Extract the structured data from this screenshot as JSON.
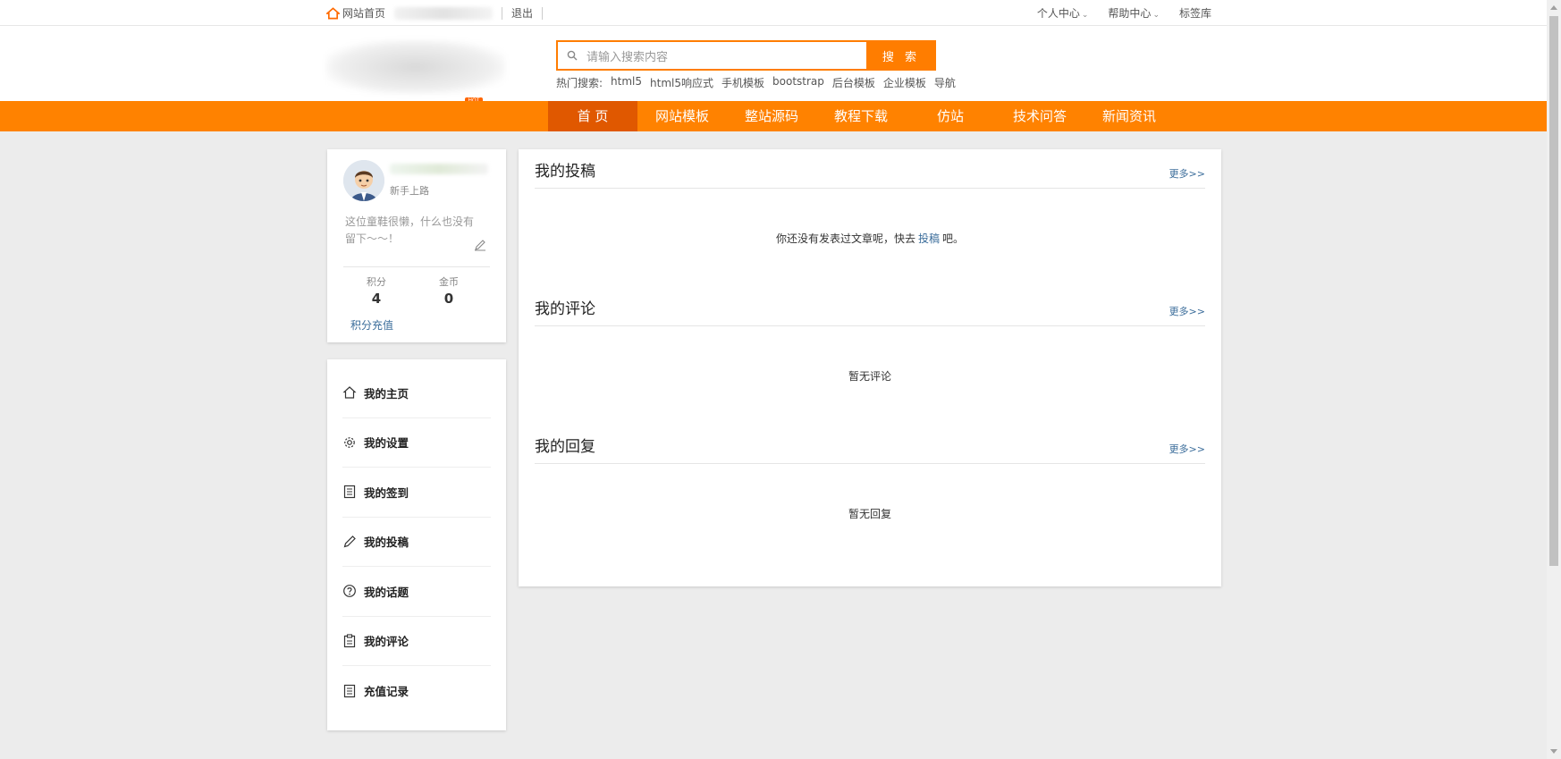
{
  "topbar": {
    "home": "网站首页",
    "logout": "退出",
    "right": [
      {
        "label": "个人中心",
        "has_arrow": true
      },
      {
        "label": "帮助中心",
        "has_arrow": true
      },
      {
        "label": "标签库",
        "has_arrow": false
      }
    ]
  },
  "header": {
    "hot_badge": "HOT",
    "search_placeholder": "请输入搜索内容",
    "search_button": "搜 索",
    "hot_label": "热门搜索:",
    "hot_terms": [
      "html5",
      "html5响应式",
      "手机模板",
      "bootstrap",
      "后台模板",
      "企业模板",
      "导航"
    ]
  },
  "nav": {
    "items": [
      "首 页",
      "网站模板",
      "整站源码",
      "教程下载",
      "仿站",
      "技术问答",
      "新闻资讯"
    ],
    "active_index": 0
  },
  "profile": {
    "level": "新手上路",
    "bio": "这位童鞋很懒，什么也没有留下～～！",
    "stats": [
      {
        "label": "积分",
        "value": "4"
      },
      {
        "label": "金币",
        "value": "0"
      }
    ],
    "recharge": "积分充值"
  },
  "menu": {
    "items": [
      {
        "label": "我的主页",
        "icon": "home-icon"
      },
      {
        "label": "我的设置",
        "icon": "gear-icon"
      },
      {
        "label": "我的签到",
        "icon": "list-icon"
      },
      {
        "label": "我的投稿",
        "icon": "pencil-icon"
      },
      {
        "label": "我的话题",
        "icon": "question-icon"
      },
      {
        "label": "我的评论",
        "icon": "clipboard-icon"
      },
      {
        "label": "充值记录",
        "icon": "list-icon"
      }
    ]
  },
  "main": {
    "sections": [
      {
        "title": "我的投稿",
        "more": "更多>>",
        "empty_prefix": "你还没有发表过文章呢，快去",
        "empty_link": "投稿",
        "empty_suffix": "吧。"
      },
      {
        "title": "我的评论",
        "more": "更多>>",
        "empty": "暂无评论"
      },
      {
        "title": "我的回复",
        "more": "更多>>",
        "empty": "暂无回复"
      }
    ]
  },
  "colors": {
    "accent": "#ff8200",
    "nav_active": "#e05800",
    "link": "#3a6c9a"
  }
}
